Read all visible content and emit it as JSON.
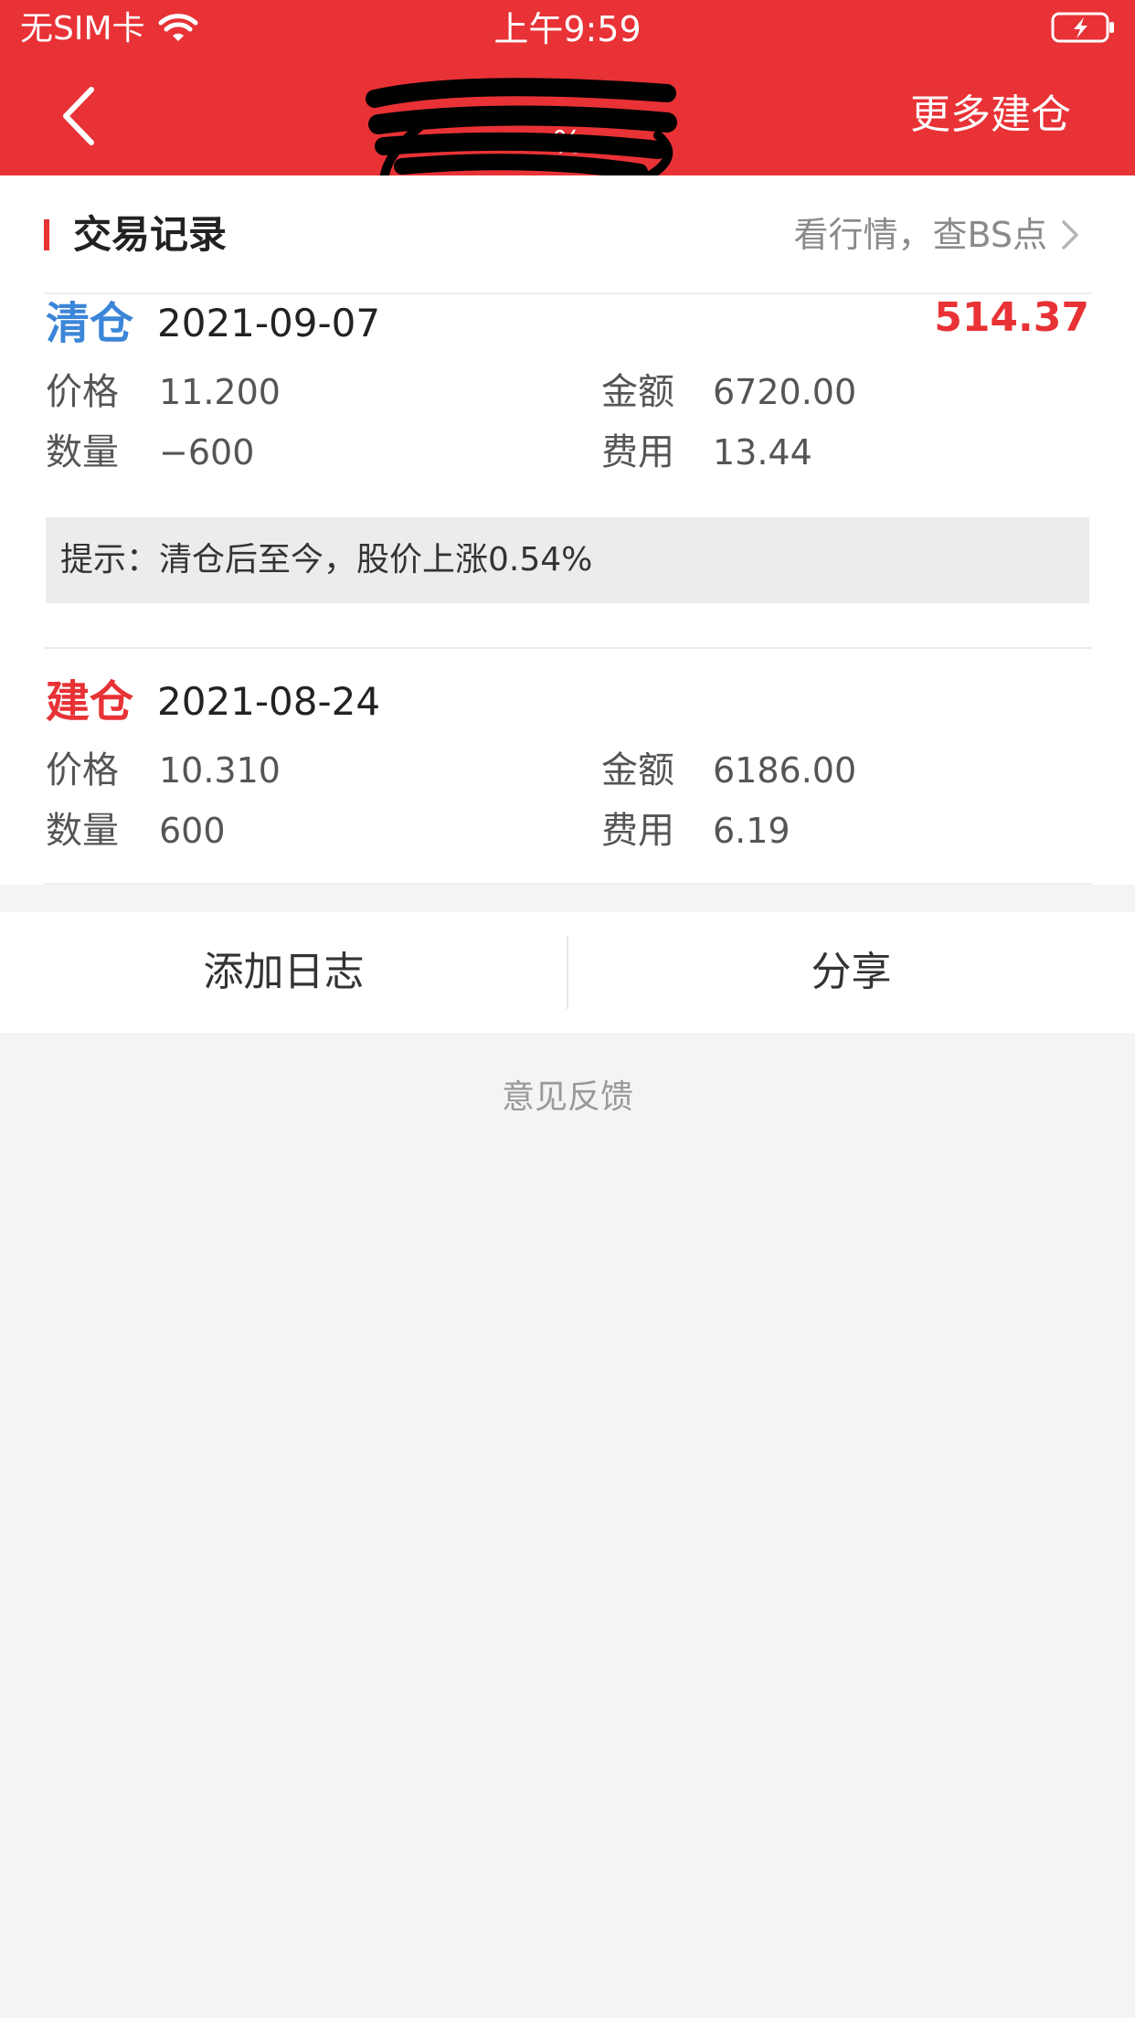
{
  "status": {
    "carrier": "无SIM卡",
    "time": "上午9:59"
  },
  "header": {
    "title": "",
    "subtitle": "%",
    "more_label": "更多建仓"
  },
  "section": {
    "title": "交易记录",
    "link": "看行情，查BS点"
  },
  "records": [
    {
      "type": "清仓",
      "date": "2021-09-07",
      "profit": "514.37",
      "price_label": "价格",
      "price": "11.200",
      "amount_label": "金额",
      "amount": "6720.00",
      "qty_label": "数量",
      "qty": "−600",
      "fee_label": "费用",
      "fee": "13.44"
    },
    {
      "type": "建仓",
      "date": "2021-08-24",
      "price_label": "价格",
      "price": "10.310",
      "amount_label": "金额",
      "amount": "6186.00",
      "qty_label": "数量",
      "qty": "600",
      "fee_label": "费用",
      "fee": "6.19"
    }
  ],
  "tip": "提示：清仓后至今，股价上涨0.54%",
  "actions": {
    "add_log": "添加日志",
    "share": "分享"
  },
  "feedback": "意见反馈",
  "colors": {
    "brand": "#e83236",
    "sell": "#3b86d8",
    "buy": "#e83236"
  }
}
